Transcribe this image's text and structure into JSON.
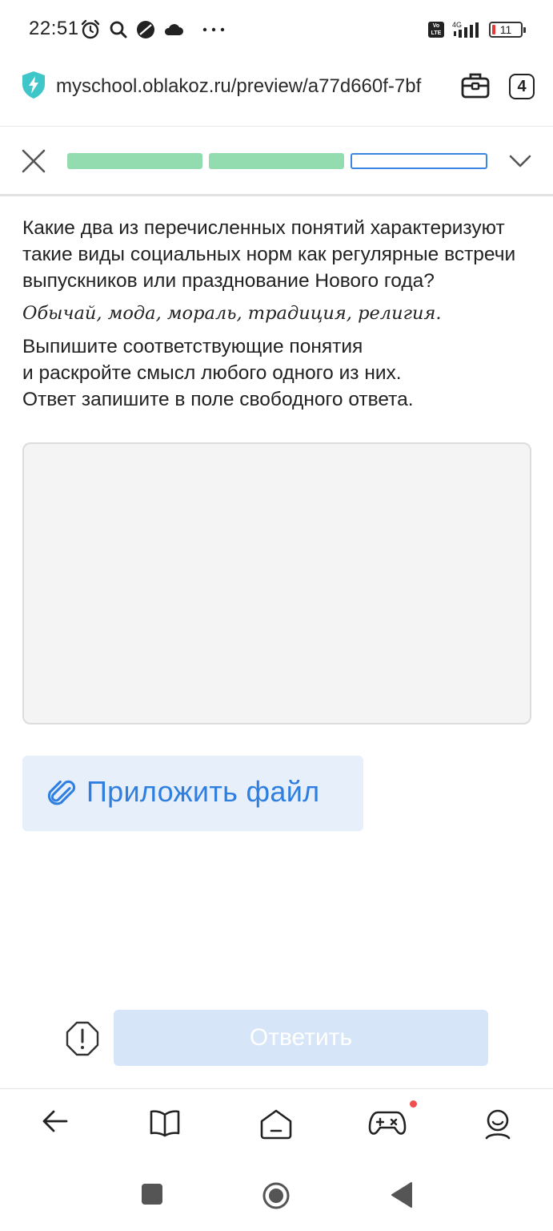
{
  "status_bar": {
    "time": "22:51",
    "battery_level": "11",
    "network": "4G",
    "left_icons": [
      "alarm-icon",
      "search-icon",
      "app-icon",
      "cloud-icon",
      "more-icon"
    ],
    "right_icons": [
      "volte-icon",
      "signal-icon",
      "battery-icon"
    ]
  },
  "browser": {
    "url": "myschool.oblakoz.ru/preview/a77d660f-7bf",
    "tab_count": "4"
  },
  "quiz": {
    "progress": {
      "total": 3,
      "completed": 2,
      "current": 3
    },
    "question_text": "Какие два из перечисленных понятий характеризуют такие виды социальных норм как регулярные встречи выпускников или празднование Нового года?",
    "options_text": "Обычай, мода, мораль, традиция, религия.",
    "instruction_line1": "Выпишите соответствующие понятия",
    "instruction_line2": "и раскройте смысл любого одного из них.",
    "instruction_line3": "Ответ запишите в поле свободного ответа.",
    "answer_value": "",
    "attach_label": "Приложить файл",
    "submit_label": "Ответить"
  },
  "colors": {
    "progress_done": "#93dcb0",
    "progress_current": "#3b86e0",
    "accent": "#2f7fe0",
    "attach_bg": "#e6effa",
    "submit_bg_disabled": "#d6e6f8"
  },
  "bottom_nav": [
    "back-arrow-icon",
    "book-icon",
    "home-icon",
    "gamepad-icon",
    "profile-icon"
  ],
  "system_nav": [
    "recents-icon",
    "home-circle-icon",
    "back-triangle-icon"
  ]
}
